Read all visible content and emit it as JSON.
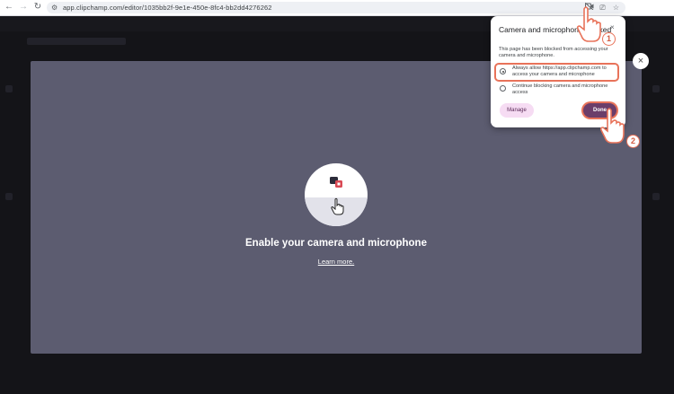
{
  "browser": {
    "url": "app.clipchamp.com/editor/1035bb2f-9e1e-450e-8fc4-bb2dd4276262",
    "icons": [
      "back-icon",
      "forward-icon",
      "reload-icon",
      "site-settings-icon",
      "camera-blocked-icon",
      "install-icon",
      "bookmark-star-icon"
    ]
  },
  "popup": {
    "title": "Camera and microphone blocked",
    "close_glyph": "×",
    "description": "This page has been blocked from accessing your camera and microphone.",
    "options": [
      {
        "label": "Always allow https://app.clipchamp.com to access your camera and microphone",
        "selected": true
      },
      {
        "label": "Continue blocking camera and microphone access",
        "selected": false
      }
    ],
    "manage_label": "Manage",
    "done_label": "Done"
  },
  "main": {
    "title": "Enable your camera and microphone",
    "learn_more": "Learn more.",
    "close_glyph": "×"
  },
  "annotations": {
    "step1": "1",
    "step2": "2",
    "highlight_color": "#e8735a"
  }
}
